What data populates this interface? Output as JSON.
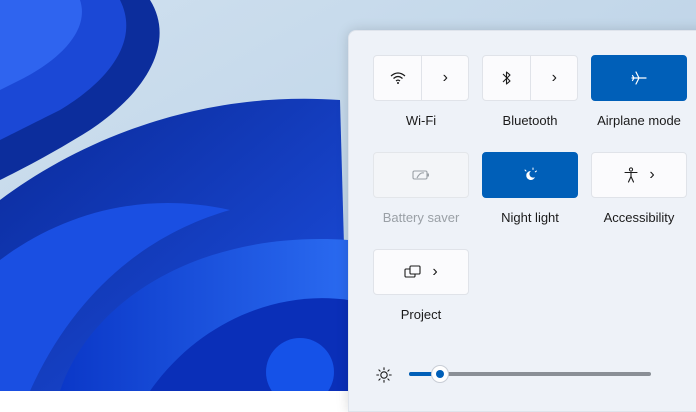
{
  "quick_settings": {
    "tiles": {
      "wifi": {
        "label": "Wi-Fi",
        "icon": "wifi-icon",
        "state": "off"
      },
      "bluetooth": {
        "label": "Bluetooth",
        "icon": "bluetooth-icon",
        "state": "off"
      },
      "airplane": {
        "label": "Airplane mode",
        "icon": "airplane-icon",
        "state": "on"
      },
      "battery_saver": {
        "label": "Battery saver",
        "icon": "battery-saver-icon",
        "state": "disabled"
      },
      "night_light": {
        "label": "Night light",
        "icon": "night-light-icon",
        "state": "on"
      },
      "accessibility": {
        "label": "Accessibility",
        "icon": "accessibility-icon",
        "state": "off"
      },
      "project": {
        "label": "Project",
        "icon": "project-icon",
        "state": "off"
      }
    },
    "brightness": {
      "icon": "brightness-icon",
      "value": 0.13
    }
  },
  "colors": {
    "accent": "#005fb8",
    "panel": "#eef2f8",
    "tile": "#fbfbfd"
  }
}
